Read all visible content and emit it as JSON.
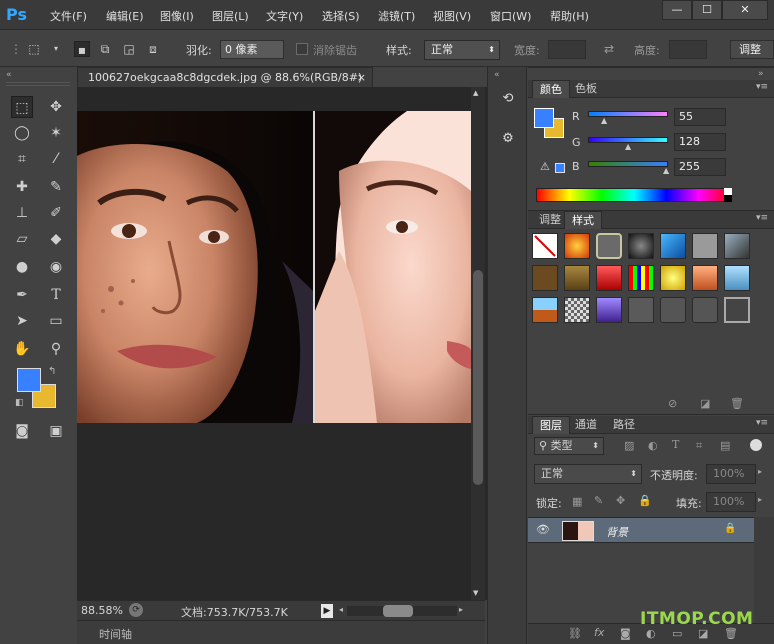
{
  "app": {
    "logo": "Ps"
  },
  "menu": {
    "file": "文件(F)",
    "edit": "编辑(E)",
    "image": "图像(I)",
    "layer": "图层(L)",
    "text": "文字(Y)",
    "select": "选择(S)",
    "filter": "滤镜(T)",
    "view": "视图(V)",
    "window": "窗口(W)",
    "help": "帮助(H)"
  },
  "window_buttons": {
    "minimize": "—",
    "restore": "☐",
    "close": "✕"
  },
  "options": {
    "feather_label": "羽化:",
    "feather_value": "0 像素",
    "antialias_label": "消除锯齿",
    "style_label": "样式:",
    "style_value": "正常",
    "width_label": "宽度:",
    "height_label": "高度:",
    "refine_label": "调整"
  },
  "document": {
    "tab_title": "100627oekgcaa8c8dgcdek.jpg @ 88.6%(RGB/8#)",
    "tab_close": "×",
    "zoom": "88.58%",
    "doc_info": "文档:753.7K/753.7K",
    "timeline_label": "时间轴"
  },
  "color_panel": {
    "tabs": [
      "颜色",
      "色板"
    ],
    "r_label": "R",
    "g_label": "G",
    "b_label": "B",
    "r_value": "55",
    "g_value": "128",
    "b_value": "255",
    "foreground": "#3780ff",
    "background": "#e8b82f"
  },
  "styles_panel": {
    "tabs": [
      "调整",
      "样式"
    ]
  },
  "layers_panel": {
    "tabs": [
      "图层",
      "通道",
      "路径"
    ],
    "filter_kind": "类型",
    "blend_mode": "正常",
    "opacity_label": "不透明度:",
    "opacity_value": "100%",
    "lock_label": "锁定:",
    "fill_label": "填充:",
    "fill_value": "100%",
    "layer_name": "背景"
  },
  "watermark": "ITMOP.COM",
  "icons": {
    "marquee": "rect-marquee-icon",
    "move": "move-icon",
    "lasso": "lasso-icon",
    "magic": "magic-wand-icon",
    "crop": "crop-icon",
    "eyedropper": "eyedropper-icon"
  }
}
